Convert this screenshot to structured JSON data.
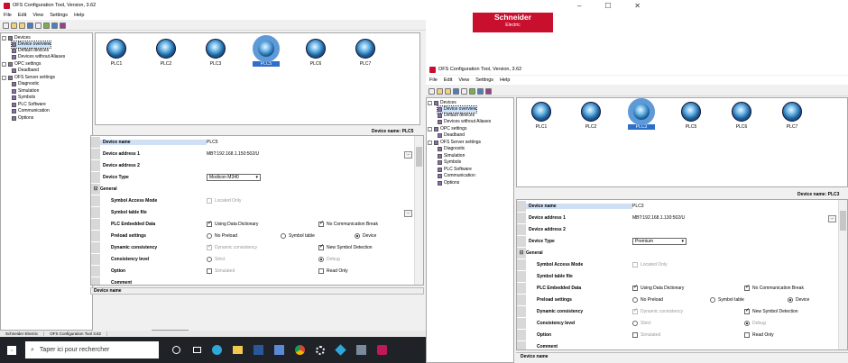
{
  "brand": {
    "name": "Schneider",
    "sub": "Electric"
  },
  "left": {
    "title": "OFS Configuration Tool,  Version, 3.62",
    "menu": [
      "File",
      "Edit",
      "View",
      "Settings",
      "Help"
    ],
    "tree": [
      {
        "label": "Devices"
      },
      {
        "label": "Device overview"
      },
      {
        "label": "Default devices"
      },
      {
        "label": "Devices without Aliases"
      },
      {
        "label": "OPC settings"
      },
      {
        "label": "Deadband"
      },
      {
        "label": "OFS Server settings"
      },
      {
        "label": "Diagnostic"
      },
      {
        "label": "Simulation"
      },
      {
        "label": "Symbols"
      },
      {
        "label": "PLC Software"
      },
      {
        "label": "Communication"
      },
      {
        "label": "Options"
      }
    ],
    "devices": [
      "PLC1",
      "PLC2",
      "PLC3",
      "PLC5",
      "PLC6",
      "PLC7"
    ],
    "device_name_label": "Device name:",
    "device_name_value": "PLC5",
    "props": {
      "device_name": {
        "k": "Device name",
        "v": "PLC5"
      },
      "addr1": {
        "k": "Device address 1",
        "v": "MBT:192.168.1.150:502/U"
      },
      "addr2": {
        "k": "Device address 2"
      },
      "type": {
        "k": "Device Type",
        "v": "Modicon M340"
      },
      "general": "General",
      "sym_mode": {
        "k": "Symbol Access Mode",
        "v": "Located Only"
      },
      "sym_file": {
        "k": "Symbol table file"
      },
      "plc_emb": {
        "k": "PLC Embedded Data",
        "o1": "Using Data Dictionary",
        "o2": "No Communication Break"
      },
      "preload": {
        "k": "Preload settings",
        "o1": "No Preload",
        "o2": "Symbol table",
        "o3": "Device"
      },
      "dyn": {
        "k": "Dynamic consistency",
        "o1": "Dynamic consistency",
        "o2": "New Symbol Detection"
      },
      "cons": {
        "k": "Consistency level",
        "o1": "Strict",
        "o2": "Debug"
      },
      "option": {
        "k": "Option",
        "o1": "Simulated",
        "o2": "Read Only"
      },
      "comment": {
        "k": "Comment"
      }
    },
    "footer": "Device name",
    "tooltip": "Parler à Cortana",
    "status": [
      "Schneider Electric",
      "OFS Configuration Tool 3.62"
    ],
    "search_placeholder": "Taper ici pour rechercher"
  },
  "right": {
    "title": "OFS Configuration Tool,  Version, 3.62",
    "menu": [
      "File",
      "Edit",
      "View",
      "Settings",
      "Help"
    ],
    "tree": [
      {
        "label": "Devices"
      },
      {
        "label": "Device overview"
      },
      {
        "label": "Default devices"
      },
      {
        "label": "Devices without Aliases"
      },
      {
        "label": "OPC settings"
      },
      {
        "label": "Deadband"
      },
      {
        "label": "OFS Server settings"
      },
      {
        "label": "Diagnostic"
      },
      {
        "label": "Simulation"
      },
      {
        "label": "Symbols"
      },
      {
        "label": "PLC Software"
      },
      {
        "label": "Communication"
      },
      {
        "label": "Options"
      }
    ],
    "devices": [
      "PLC1",
      "PLC2",
      "PLC3",
      "PLC5",
      "PLC6",
      "PLC7"
    ],
    "device_name_label": "Device name:",
    "device_name_value": "PLC3",
    "props": {
      "device_name": {
        "k": "Device name",
        "v": "PLC3"
      },
      "addr1": {
        "k": "Device address 1",
        "v": "MBT:192.168.1.130:502/U"
      },
      "addr2": {
        "k": "Device address 2"
      },
      "type": {
        "k": "Device Type",
        "v": "Premium"
      },
      "general": "General",
      "sym_mode": {
        "k": "Symbol Access Mode",
        "v": "Located Only"
      },
      "sym_file": {
        "k": "Symbol table file"
      },
      "plc_emb": {
        "k": "PLC Embedded Data",
        "o1": "Using Data Dictionary",
        "o2": "No Communication Break"
      },
      "preload": {
        "k": "Preload settings",
        "o1": "No Preload",
        "o2": "Symbol table",
        "o3": "Device"
      },
      "dyn": {
        "k": "Dynamic consistency",
        "o1": "Dynamic consistency",
        "o2": "New Symbol Detection"
      },
      "cons": {
        "k": "Consistency level",
        "o1": "Strict",
        "o2": "Debug"
      },
      "option": {
        "k": "Option",
        "o1": "Simulated",
        "o2": "Read Only"
      },
      "comment": {
        "k": "Comment"
      }
    },
    "footer": "Device name"
  }
}
